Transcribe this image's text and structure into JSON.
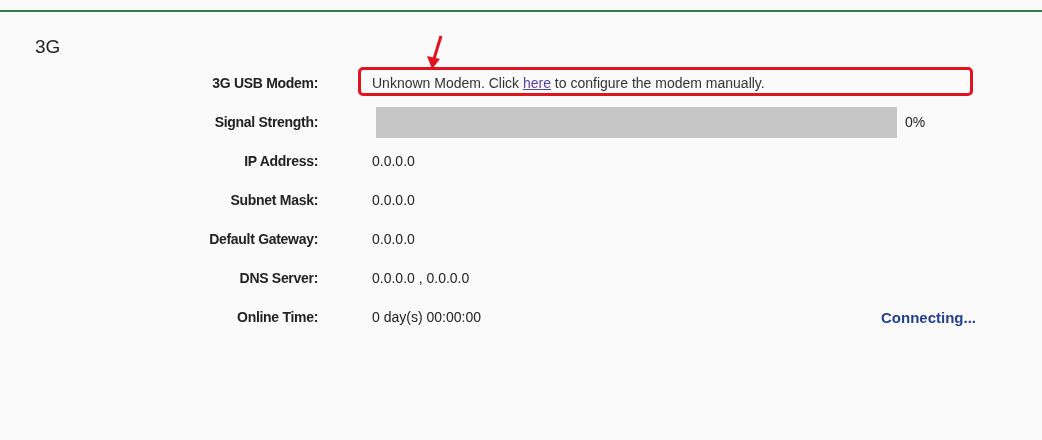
{
  "section_title": "3G",
  "modem": {
    "label": "3G USB Modem:",
    "text_before": "Unknown Modem. Click ",
    "link": "here",
    "text_after": " to configure the modem manually.",
    "highlighted": true
  },
  "signal": {
    "label": "Signal Strength:",
    "level": 0,
    "reading": "0%"
  },
  "fields": [
    {
      "label": "IP Address:",
      "value": "0.0.0.0"
    },
    {
      "label": "Subnet Mask:",
      "value": "0.0.0.0"
    },
    {
      "label": "Default Gateway:",
      "value": "0.0.0.0"
    },
    {
      "label": "DNS Server:",
      "value": "0.0.0.0 , 0.0.0.0"
    }
  ],
  "online_time": {
    "label": "Online Time:",
    "value": "0 day(s) 00:00:00",
    "status": "Connecting..."
  }
}
